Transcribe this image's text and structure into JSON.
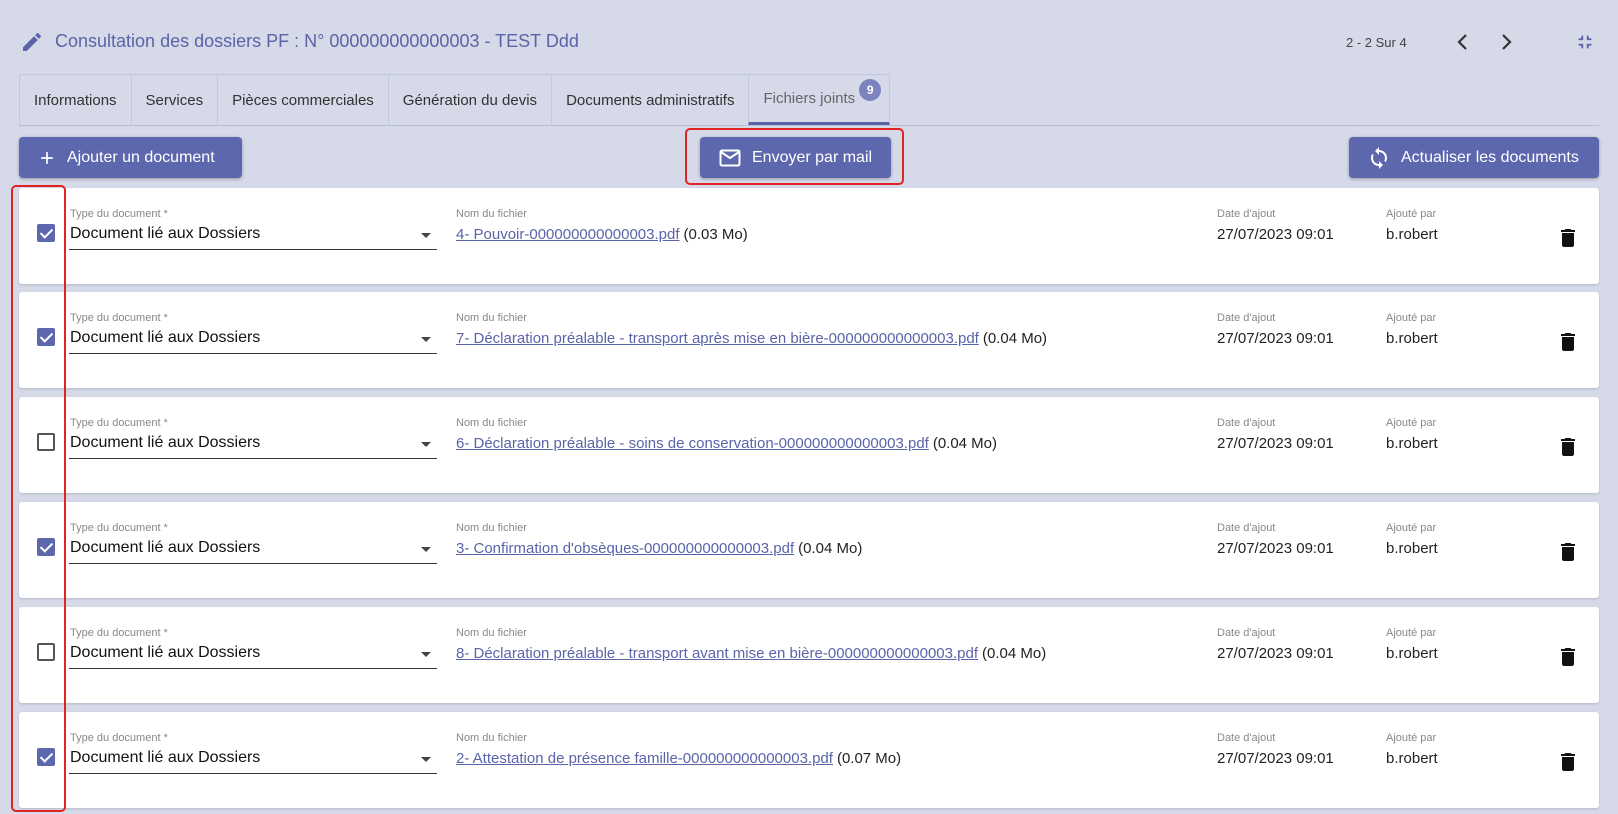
{
  "header": {
    "title": "Consultation des dossiers PF : N° 000000000000003 - TEST Ddd",
    "pager": "2 - 2 Sur 4"
  },
  "tabs": [
    {
      "label": "Informations"
    },
    {
      "label": "Services"
    },
    {
      "label": "Pièces commerciales"
    },
    {
      "label": "Génération du devis"
    },
    {
      "label": "Documents administratifs"
    },
    {
      "label": "Fichiers joints",
      "badge": "9",
      "active": true
    }
  ],
  "toolbar": {
    "add_label": "Ajouter un document",
    "mail_label": "Envoyer par mail",
    "refresh_label": "Actualiser les documents"
  },
  "labels": {
    "type": "Type du document *",
    "file": "Nom du fichier",
    "date": "Date d'ajout",
    "by": "Ajouté par"
  },
  "documents": [
    {
      "checked": true,
      "type": "Document lié aux Dossiers",
      "file": "4- Pouvoir-000000000000003.pdf",
      "size": "(0.03 Mo)",
      "date": "27/07/2023 09:01",
      "by": "b.robert"
    },
    {
      "checked": true,
      "type": "Document lié aux Dossiers",
      "file": "7- Déclaration préalable - transport après mise en bière-000000000000003.pdf",
      "size": "(0.04 Mo)",
      "date": "27/07/2023 09:01",
      "by": "b.robert"
    },
    {
      "checked": false,
      "type": "Document lié aux Dossiers",
      "file": "6- Déclaration préalable - soins de conservation-000000000000003.pdf",
      "size": "(0.04 Mo)",
      "date": "27/07/2023 09:01",
      "by": "b.robert"
    },
    {
      "checked": true,
      "type": "Document lié aux Dossiers",
      "file": "3- Confirmation d'obsèques-000000000000003.pdf",
      "size": "(0.04 Mo)",
      "date": "27/07/2023 09:01",
      "by": "b.robert"
    },
    {
      "checked": false,
      "type": "Document lié aux Dossiers",
      "file": "8- Déclaration préalable - transport avant mise en bière-000000000000003.pdf",
      "size": "(0.04 Mo)",
      "date": "27/07/2023 09:01",
      "by": "b.robert"
    },
    {
      "checked": true,
      "type": "Document lié aux Dossiers",
      "file": "2- Attestation de présence famille-000000000000003.pdf",
      "size": "(0.07 Mo)",
      "date": "27/07/2023 09:01",
      "by": "b.robert"
    }
  ],
  "colors": {
    "accent": "#5d67ad",
    "title": "#5a64a8",
    "background": "#d5d9e8",
    "highlight": "#e02424"
  },
  "icons": {
    "edit": "pencil-icon",
    "prev": "chevron-left-icon",
    "next": "chevron-right-icon",
    "collapse": "collapse-icon",
    "add": "plus-icon",
    "mail": "mail-icon",
    "refresh": "refresh-icon",
    "delete": "trash-icon"
  }
}
